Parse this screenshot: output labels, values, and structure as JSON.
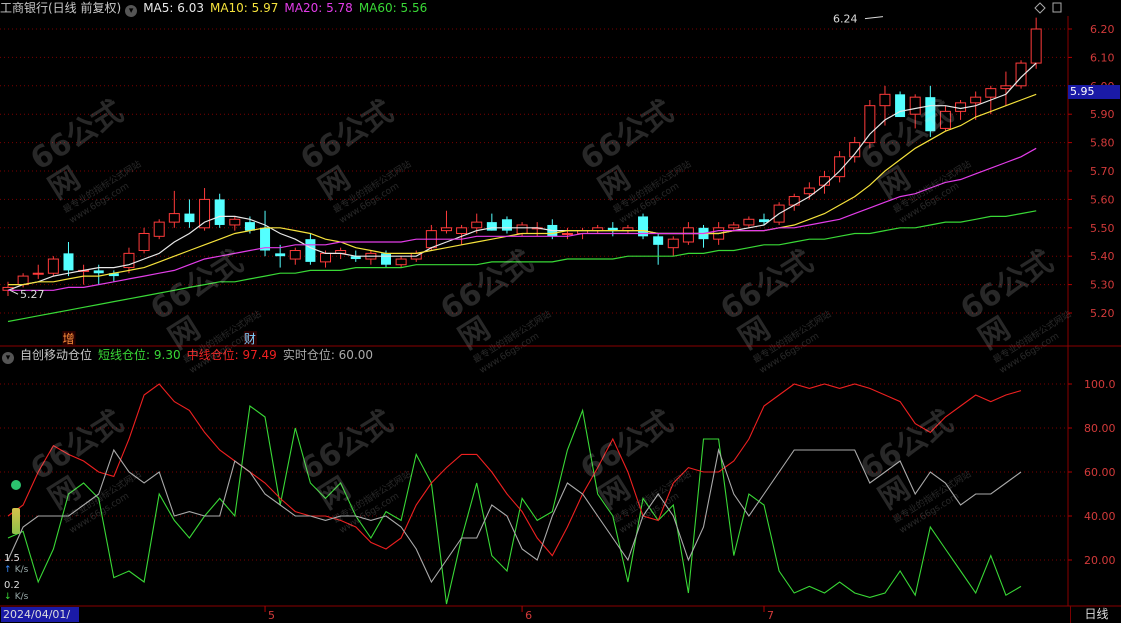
{
  "header": {
    "stock_title": "工商银行(日线 前复权)",
    "ma_legend": [
      {
        "label": "MA5: 6.03",
        "color": "#e8e8e8"
      },
      {
        "label": "MA10: 5.97",
        "color": "#f5e23c"
      },
      {
        "label": "MA20: 5.78",
        "color": "#e23ce8"
      },
      {
        "label": "MA60: 5.56",
        "color": "#39d836"
      }
    ]
  },
  "indicator_header": {
    "name": "自创移动仓位",
    "items": [
      {
        "label": "短线仓位: 9.30",
        "color": "#39d836"
      },
      {
        "label": "中线仓位: 97.49",
        "color": "#ee2020"
      },
      {
        "label": "实时仓位: 60.00",
        "color": "#aaaaaa"
      }
    ]
  },
  "current_price_tag": "5.95",
  "date_label": "2024/04/01/一",
  "period_label": "日线",
  "speed": [
    {
      "value": "1.5",
      "unit": "K/s",
      "arrow": "↑"
    },
    {
      "value": "0.2",
      "unit": "K/s",
      "arrow": "↓"
    }
  ],
  "watermark": {
    "big": "66公式网",
    "small": "最专业的指标公式网站 www.66gs.com"
  },
  "chart_data": [
    {
      "type": "candlestick",
      "price_axis": {
        "ticks": [
          6.2,
          6.1,
          6.0,
          5.9,
          5.8,
          5.7,
          5.6,
          5.5,
          5.4,
          5.3,
          5.2
        ],
        "ylim": [
          5.15,
          6.25
        ]
      },
      "annotations": [
        {
          "text": "6.24",
          "index": 58
        },
        {
          "text": "5.27",
          "index": 0
        }
      ],
      "event_markers": [
        {
          "text": "增",
          "index": 4
        },
        {
          "text": "财",
          "index": 16
        }
      ],
      "x_ticks": [
        {
          "label": "5",
          "index": 17
        },
        {
          "label": "6",
          "index": 34
        },
        {
          "label": "7",
          "index": 50
        }
      ],
      "candles": [
        {
          "o": 5.28,
          "h": 5.31,
          "l": 5.26,
          "c": 5.29
        },
        {
          "o": 5.3,
          "h": 5.34,
          "l": 5.29,
          "c": 5.33
        },
        {
          "o": 5.34,
          "h": 5.37,
          "l": 5.32,
          "c": 5.34
        },
        {
          "o": 5.34,
          "h": 5.4,
          "l": 5.33,
          "c": 5.39
        },
        {
          "o": 5.41,
          "h": 5.45,
          "l": 5.33,
          "c": 5.35
        },
        {
          "o": 5.35,
          "h": 5.37,
          "l": 5.3,
          "c": 5.35
        },
        {
          "o": 5.35,
          "h": 5.37,
          "l": 5.3,
          "c": 5.34
        },
        {
          "o": 5.34,
          "h": 5.35,
          "l": 5.31,
          "c": 5.33
        },
        {
          "o": 5.36,
          "h": 5.43,
          "l": 5.34,
          "c": 5.41
        },
        {
          "o": 5.42,
          "h": 5.5,
          "l": 5.41,
          "c": 5.48
        },
        {
          "o": 5.47,
          "h": 5.53,
          "l": 5.46,
          "c": 5.52
        },
        {
          "o": 5.52,
          "h": 5.63,
          "l": 5.5,
          "c": 5.55
        },
        {
          "o": 5.55,
          "h": 5.6,
          "l": 5.5,
          "c": 5.52
        },
        {
          "o": 5.5,
          "h": 5.64,
          "l": 5.49,
          "c": 5.6
        },
        {
          "o": 5.6,
          "h": 5.62,
          "l": 5.5,
          "c": 5.51
        },
        {
          "o": 5.51,
          "h": 5.54,
          "l": 5.49,
          "c": 5.53
        },
        {
          "o": 5.52,
          "h": 5.54,
          "l": 5.48,
          "c": 5.49
        },
        {
          "o": 5.5,
          "h": 5.56,
          "l": 5.4,
          "c": 5.42
        },
        {
          "o": 5.41,
          "h": 5.44,
          "l": 5.36,
          "c": 5.4
        },
        {
          "o": 5.39,
          "h": 5.43,
          "l": 5.37,
          "c": 5.42
        },
        {
          "o": 5.46,
          "h": 5.48,
          "l": 5.37,
          "c": 5.38
        },
        {
          "o": 5.38,
          "h": 5.42,
          "l": 5.36,
          "c": 5.41
        },
        {
          "o": 5.41,
          "h": 5.43,
          "l": 5.39,
          "c": 5.42
        },
        {
          "o": 5.4,
          "h": 5.42,
          "l": 5.38,
          "c": 5.39
        },
        {
          "o": 5.39,
          "h": 5.42,
          "l": 5.37,
          "c": 5.41
        },
        {
          "o": 5.41,
          "h": 5.42,
          "l": 5.36,
          "c": 5.37
        },
        {
          "o": 5.37,
          "h": 5.4,
          "l": 5.36,
          "c": 5.39
        },
        {
          "o": 5.39,
          "h": 5.42,
          "l": 5.38,
          "c": 5.41
        },
        {
          "o": 5.43,
          "h": 5.51,
          "l": 5.42,
          "c": 5.49
        },
        {
          "o": 5.49,
          "h": 5.56,
          "l": 5.48,
          "c": 5.5
        },
        {
          "o": 5.48,
          "h": 5.51,
          "l": 5.44,
          "c": 5.5
        },
        {
          "o": 5.5,
          "h": 5.55,
          "l": 5.48,
          "c": 5.52
        },
        {
          "o": 5.52,
          "h": 5.55,
          "l": 5.49,
          "c": 5.49
        },
        {
          "o": 5.53,
          "h": 5.54,
          "l": 5.48,
          "c": 5.49
        },
        {
          "o": 5.48,
          "h": 5.52,
          "l": 5.47,
          "c": 5.51
        },
        {
          "o": 5.5,
          "h": 5.52,
          "l": 5.47,
          "c": 5.5
        },
        {
          "o": 5.51,
          "h": 5.53,
          "l": 5.46,
          "c": 5.47
        },
        {
          "o": 5.48,
          "h": 5.5,
          "l": 5.46,
          "c": 5.48
        },
        {
          "o": 5.48,
          "h": 5.5,
          "l": 5.46,
          "c": 5.49
        },
        {
          "o": 5.49,
          "h": 5.51,
          "l": 5.48,
          "c": 5.5
        },
        {
          "o": 5.5,
          "h": 5.52,
          "l": 5.47,
          "c": 5.49
        },
        {
          "o": 5.49,
          "h": 5.51,
          "l": 5.48,
          "c": 5.5
        },
        {
          "o": 5.54,
          "h": 5.55,
          "l": 5.46,
          "c": 5.47
        },
        {
          "o": 5.47,
          "h": 5.48,
          "l": 5.37,
          "c": 5.44
        },
        {
          "o": 5.43,
          "h": 5.47,
          "l": 5.4,
          "c": 5.46
        },
        {
          "o": 5.45,
          "h": 5.52,
          "l": 5.44,
          "c": 5.5
        },
        {
          "o": 5.5,
          "h": 5.51,
          "l": 5.43,
          "c": 5.46
        },
        {
          "o": 5.46,
          "h": 5.52,
          "l": 5.44,
          "c": 5.5
        },
        {
          "o": 5.5,
          "h": 5.52,
          "l": 5.49,
          "c": 5.51
        },
        {
          "o": 5.51,
          "h": 5.54,
          "l": 5.5,
          "c": 5.53
        },
        {
          "o": 5.53,
          "h": 5.55,
          "l": 5.51,
          "c": 5.52
        },
        {
          "o": 5.52,
          "h": 5.59,
          "l": 5.51,
          "c": 5.58
        },
        {
          "o": 5.58,
          "h": 5.62,
          "l": 5.56,
          "c": 5.61
        },
        {
          "o": 5.62,
          "h": 5.66,
          "l": 5.6,
          "c": 5.64
        },
        {
          "o": 5.65,
          "h": 5.7,
          "l": 5.62,
          "c": 5.68
        },
        {
          "o": 5.68,
          "h": 5.77,
          "l": 5.66,
          "c": 5.75
        },
        {
          "o": 5.75,
          "h": 5.82,
          "l": 5.73,
          "c": 5.8
        },
        {
          "o": 5.8,
          "h": 5.95,
          "l": 5.78,
          "c": 5.93
        },
        {
          "o": 5.93,
          "h": 6.0,
          "l": 5.86,
          "c": 5.97
        },
        {
          "o": 5.97,
          "h": 5.98,
          "l": 5.89,
          "c": 5.89
        },
        {
          "o": 5.9,
          "h": 5.97,
          "l": 5.85,
          "c": 5.96
        },
        {
          "o": 5.96,
          "h": 6.0,
          "l": 5.82,
          "c": 5.84
        },
        {
          "o": 5.85,
          "h": 5.93,
          "l": 5.84,
          "c": 5.91
        },
        {
          "o": 5.91,
          "h": 5.95,
          "l": 5.88,
          "c": 5.94
        },
        {
          "o": 5.94,
          "h": 5.98,
          "l": 5.88,
          "c": 5.96
        },
        {
          "o": 5.96,
          "h": 6.0,
          "l": 5.9,
          "c": 5.99
        },
        {
          "o": 5.99,
          "h": 6.05,
          "l": 5.93,
          "c": 6.0
        },
        {
          "o": 6.0,
          "h": 6.09,
          "l": 5.99,
          "c": 6.08
        },
        {
          "o": 6.08,
          "h": 6.24,
          "l": 6.06,
          "c": 6.2
        }
      ],
      "series": [
        {
          "name": "MA5",
          "color": "#e8e8e8",
          "values": [
            5.28,
            5.3,
            5.31,
            5.33,
            5.34,
            5.35,
            5.36,
            5.36,
            5.37,
            5.39,
            5.41,
            5.45,
            5.48,
            5.52,
            5.54,
            5.54,
            5.53,
            5.51,
            5.48,
            5.46,
            5.43,
            5.41,
            5.41,
            5.4,
            5.4,
            5.4,
            5.4,
            5.4,
            5.43,
            5.45,
            5.47,
            5.49,
            5.5,
            5.5,
            5.5,
            5.5,
            5.49,
            5.49,
            5.49,
            5.49,
            5.49,
            5.49,
            5.49,
            5.48,
            5.48,
            5.48,
            5.48,
            5.48,
            5.49,
            5.5,
            5.51,
            5.55,
            5.58,
            5.61,
            5.65,
            5.7,
            5.76,
            5.83,
            5.88,
            5.91,
            5.92,
            5.93,
            5.93,
            5.92,
            5.93,
            5.95,
            5.97,
            6.03,
            6.08
          ]
        },
        {
          "name": "MA10",
          "color": "#f5e23c",
          "values": [
            5.3,
            5.3,
            5.31,
            5.31,
            5.32,
            5.33,
            5.33,
            5.34,
            5.35,
            5.36,
            5.38,
            5.4,
            5.42,
            5.44,
            5.46,
            5.48,
            5.49,
            5.5,
            5.5,
            5.49,
            5.48,
            5.46,
            5.45,
            5.43,
            5.42,
            5.41,
            5.41,
            5.41,
            5.42,
            5.43,
            5.44,
            5.45,
            5.46,
            5.47,
            5.48,
            5.48,
            5.48,
            5.49,
            5.49,
            5.49,
            5.49,
            5.49,
            5.49,
            5.48,
            5.48,
            5.48,
            5.48,
            5.48,
            5.49,
            5.49,
            5.49,
            5.5,
            5.51,
            5.53,
            5.55,
            5.58,
            5.61,
            5.65,
            5.7,
            5.74,
            5.78,
            5.81,
            5.84,
            5.86,
            5.89,
            5.91,
            5.93,
            5.95,
            5.97
          ]
        },
        {
          "name": "MA20",
          "color": "#e23ce8",
          "values": [
            5.28,
            5.28,
            5.28,
            5.28,
            5.29,
            5.29,
            5.3,
            5.31,
            5.32,
            5.33,
            5.34,
            5.35,
            5.37,
            5.39,
            5.4,
            5.41,
            5.42,
            5.43,
            5.43,
            5.44,
            5.44,
            5.44,
            5.45,
            5.45,
            5.45,
            5.45,
            5.45,
            5.46,
            5.46,
            5.46,
            5.46,
            5.47,
            5.47,
            5.47,
            5.47,
            5.47,
            5.47,
            5.47,
            5.48,
            5.48,
            5.48,
            5.48,
            5.48,
            5.48,
            5.48,
            5.48,
            5.48,
            5.49,
            5.49,
            5.49,
            5.49,
            5.5,
            5.5,
            5.51,
            5.52,
            5.53,
            5.55,
            5.57,
            5.59,
            5.61,
            5.62,
            5.64,
            5.66,
            5.67,
            5.69,
            5.71,
            5.73,
            5.75,
            5.78
          ]
        },
        {
          "name": "MA60",
          "color": "#39d836",
          "values": [
            5.17,
            5.18,
            5.19,
            5.2,
            5.21,
            5.22,
            5.23,
            5.24,
            5.25,
            5.26,
            5.27,
            5.28,
            5.29,
            5.3,
            5.31,
            5.31,
            5.32,
            5.33,
            5.34,
            5.34,
            5.35,
            5.35,
            5.35,
            5.36,
            5.36,
            5.36,
            5.36,
            5.37,
            5.37,
            5.37,
            5.37,
            5.37,
            5.38,
            5.38,
            5.38,
            5.38,
            5.38,
            5.39,
            5.39,
            5.39,
            5.39,
            5.4,
            5.4,
            5.4,
            5.4,
            5.41,
            5.41,
            5.42,
            5.42,
            5.43,
            5.44,
            5.44,
            5.45,
            5.46,
            5.46,
            5.47,
            5.48,
            5.48,
            5.49,
            5.5,
            5.5,
            5.51,
            5.52,
            5.52,
            5.53,
            5.54,
            5.54,
            5.55,
            5.56
          ]
        }
      ]
    },
    {
      "type": "line",
      "value_axis": {
        "ticks": [
          100.0,
          80.0,
          60.0,
          40.0,
          20.0
        ],
        "ylim": [
          0,
          105
        ]
      },
      "series": [
        {
          "name": "短线仓位",
          "color": "#39d836",
          "values": [
            30,
            33,
            10,
            25,
            50,
            55,
            48,
            12,
            15,
            10,
            50,
            38,
            30,
            40,
            48,
            40,
            90,
            85,
            45,
            80,
            55,
            48,
            55,
            40,
            30,
            42,
            38,
            68,
            55,
            0,
            30,
            55,
            22,
            15,
            48,
            38,
            42,
            70,
            88,
            50,
            40,
            10,
            48,
            38,
            45,
            5,
            75,
            75,
            22,
            50,
            45,
            15,
            5,
            8,
            5,
            10,
            5,
            3,
            5,
            15,
            4,
            35,
            25,
            15,
            5,
            22,
            4,
            8
          ]
        },
        {
          "name": "中线仓位",
          "color": "#ee2020",
          "values": [
            40,
            45,
            60,
            72,
            68,
            65,
            60,
            58,
            75,
            95,
            100,
            92,
            88,
            78,
            70,
            65,
            60,
            55,
            48,
            42,
            40,
            40,
            38,
            35,
            28,
            25,
            30,
            45,
            55,
            62,
            68,
            68,
            60,
            50,
            42,
            30,
            22,
            35,
            50,
            62,
            75,
            60,
            40,
            38,
            55,
            62,
            60,
            60,
            65,
            75,
            90,
            95,
            100,
            98,
            100,
            98,
            100,
            98,
            95,
            92,
            82,
            78,
            85,
            90,
            95,
            92,
            95,
            97
          ]
        },
        {
          "name": "实时仓位",
          "color": "#aaaaaa",
          "values": [
            20,
            35,
            40,
            40,
            40,
            45,
            50,
            70,
            60,
            55,
            60,
            40,
            42,
            40,
            40,
            65,
            60,
            50,
            45,
            40,
            40,
            38,
            40,
            40,
            38,
            40,
            35,
            25,
            10,
            20,
            30,
            30,
            45,
            40,
            25,
            20,
            40,
            55,
            50,
            40,
            30,
            20,
            40,
            50,
            40,
            20,
            35,
            70,
            50,
            40,
            50,
            60,
            70,
            70,
            70,
            70,
            70,
            55,
            60,
            65,
            50,
            60,
            55,
            45,
            50,
            50,
            55,
            60
          ]
        }
      ]
    }
  ]
}
